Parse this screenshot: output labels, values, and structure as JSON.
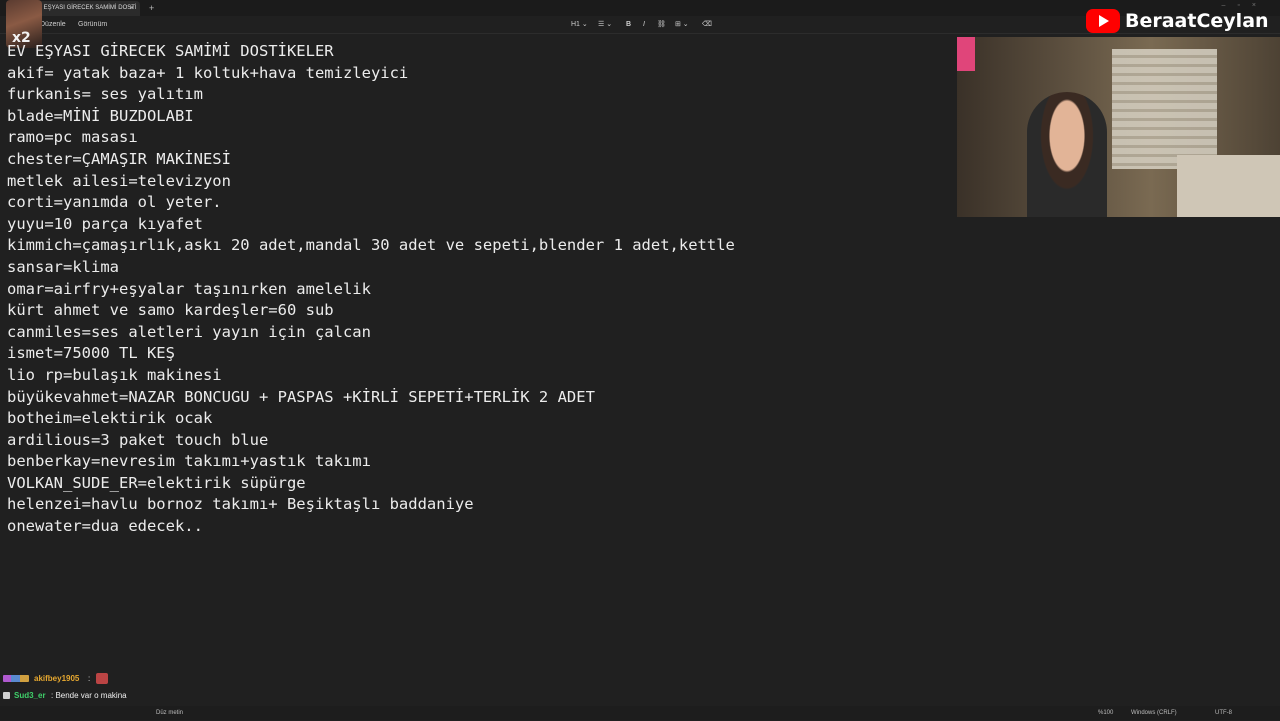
{
  "window": {
    "tab_title": "EV EŞYASI GİRECEK SAMİMİ DOSTİ",
    "tab_close": "×",
    "new_tab": "+",
    "controls": "–▫×"
  },
  "menubar": {
    "items": [
      "Düzenle",
      "Görünüm"
    ],
    "toolbar": {
      "heading": "H1 ⌄",
      "list": "☰ ⌄",
      "bold": "B",
      "italic": "I",
      "link": "⛓",
      "table": "⊞ ⌄",
      "clear": "⌫"
    }
  },
  "avatar": {
    "badge_text": "x2"
  },
  "document": {
    "lines": [
      "EV EŞYASI GİRECEK SAMİMİ DOSTİKELER",
      "akif= yatak baza+ 1 koltuk+hava temizleyici",
      "furkanis= ses yalıtım",
      "blade=MİNİ BUZDOLABI",
      "ramo=pc masası",
      "chester=ÇAMAŞIR MAKİNESİ",
      "metlek ailesi=televizyon",
      "corti=yanımda ol yeter.",
      "yuyu=10 parça kıyafet",
      "kimmich=çamaşırlık,askı 20 adet,mandal 30 adet ve sepeti,blender 1 adet,kettle",
      "sansar=klima",
      "omar=airfry+eşyalar taşınırken amelelik",
      "kürt ahmet ve samo kardeşler=60 sub",
      "canmiles=ses aletleri yayın için çalcan",
      "ismet=75000 TL KEŞ",
      "lio rp=bulaşık makinesi",
      "büyükevahmet=NAZAR BONCUGU + PASPAS +KİRLİ SEPETİ+TERLİK 2 ADET",
      "botheim=elektirik ocak",
      "ardilious=3 paket touch blue",
      "benberkay=nevresim takımı+yastık takımı",
      "VOLKAN_SUDE_ER=elektirik süpürge",
      "helenzei=havlu bornoz takımı+ Beşiktaşlı baddaniye",
      "onewater=dua edecek.."
    ]
  },
  "overlay": {
    "channel_name": "BeraatCeylan",
    "logo": "youtube-logo"
  },
  "chat": [
    {
      "user": "akifbey1905",
      "message": ":",
      "has_emote": true,
      "color": "#e6a830"
    },
    {
      "user": "Sud3_er",
      "message": ": Bende var o makina",
      "has_emote": false,
      "color": "#3fd06a"
    },
    {
      "user": "akifbey1905",
      "message": ":",
      "has_emote": true,
      "color": "#e6a830"
    }
  ],
  "statusbar": {
    "mode": "Düz metin",
    "zoom": "%100",
    "line_endings": "Windows (CRLF)",
    "encoding": "UTF-8"
  },
  "colors": {
    "background": "#202020",
    "text": "#ececec",
    "youtube_red": "#ff0000"
  }
}
